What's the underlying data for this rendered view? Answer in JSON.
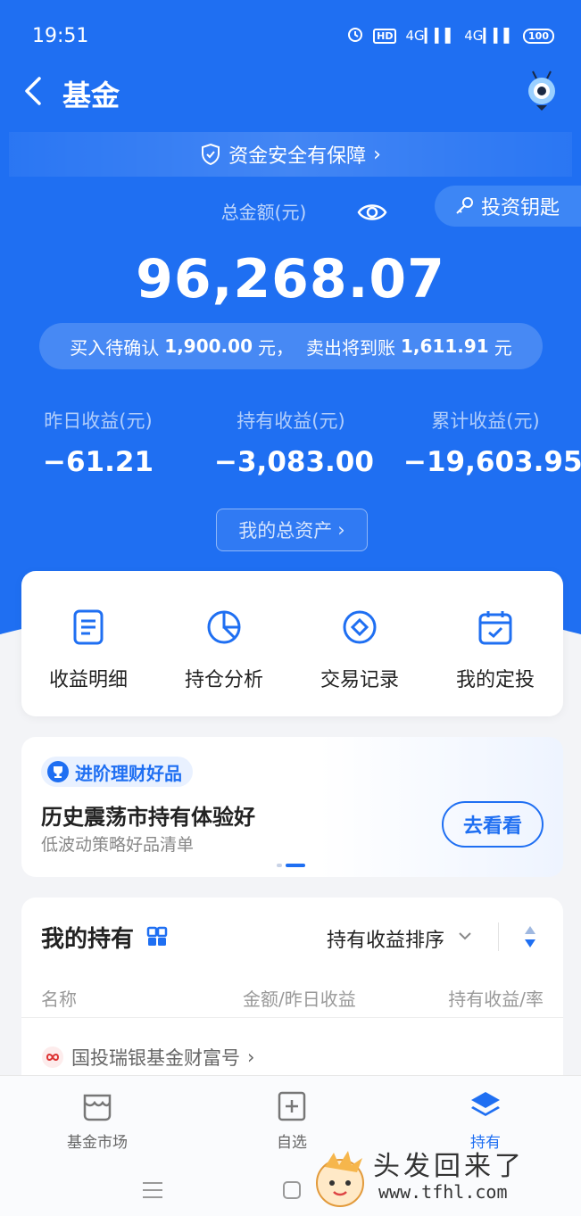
{
  "status_bar": {
    "time": "19:51",
    "hd": "HD",
    "net1": "4G",
    "net2": "4G",
    "battery": "100"
  },
  "nav": {
    "title": "基金"
  },
  "safety_banner": {
    "text": "资金安全有保障",
    "arrow": "›"
  },
  "key_button": {
    "label": "投资钥匙"
  },
  "summary": {
    "total_label": "总金额(元)",
    "total_amount": "96,268.07",
    "pending_buy_label": "买入待确认",
    "pending_buy_value": "1,900.00",
    "pending_buy_unit": "元，",
    "pending_sell_label": "卖出将到账",
    "pending_sell_value": "1,611.91",
    "pending_sell_unit": "元"
  },
  "stats": [
    {
      "label": "昨日收益(元)",
      "value": "−61.21"
    },
    {
      "label": "持有收益(元)",
      "value": "−3,083.00"
    },
    {
      "label": "累计收益(元)",
      "value": "−19,603.95"
    }
  ],
  "assets_button": {
    "label": "我的总资产",
    "arrow": "›"
  },
  "quick_actions": [
    {
      "label": "收益明细",
      "icon": "document-icon"
    },
    {
      "label": "持仓分析",
      "icon": "pie-chart-icon"
    },
    {
      "label": "交易记录",
      "icon": "diamond-circle-icon"
    },
    {
      "label": "我的定投",
      "icon": "calendar-check-icon"
    }
  ],
  "promo": {
    "tag": "进阶理财好品",
    "title": "历史震荡市持有体验好",
    "subtitle": "低波动策略好品清单",
    "button": "去看看"
  },
  "holdings": {
    "title": "我的持有",
    "sort_label": "持有收益排序",
    "col_name": "名称",
    "col_amount": "金额/昨日收益",
    "col_return": "持有收益/率",
    "company": "国投瑞银基金财富号",
    "company_arrow": "›"
  },
  "tabs": [
    {
      "label": "基金市场",
      "icon": "market-icon"
    },
    {
      "label": "自选",
      "icon": "add-favorite-icon"
    },
    {
      "label": "持有",
      "icon": "layers-icon",
      "active": true
    }
  ],
  "watermark": {
    "text": "头发回来了",
    "url": "www.tfhl.com"
  },
  "colors": {
    "brand": "#1f6ff2",
    "page_bg": "#f3f4f7"
  }
}
